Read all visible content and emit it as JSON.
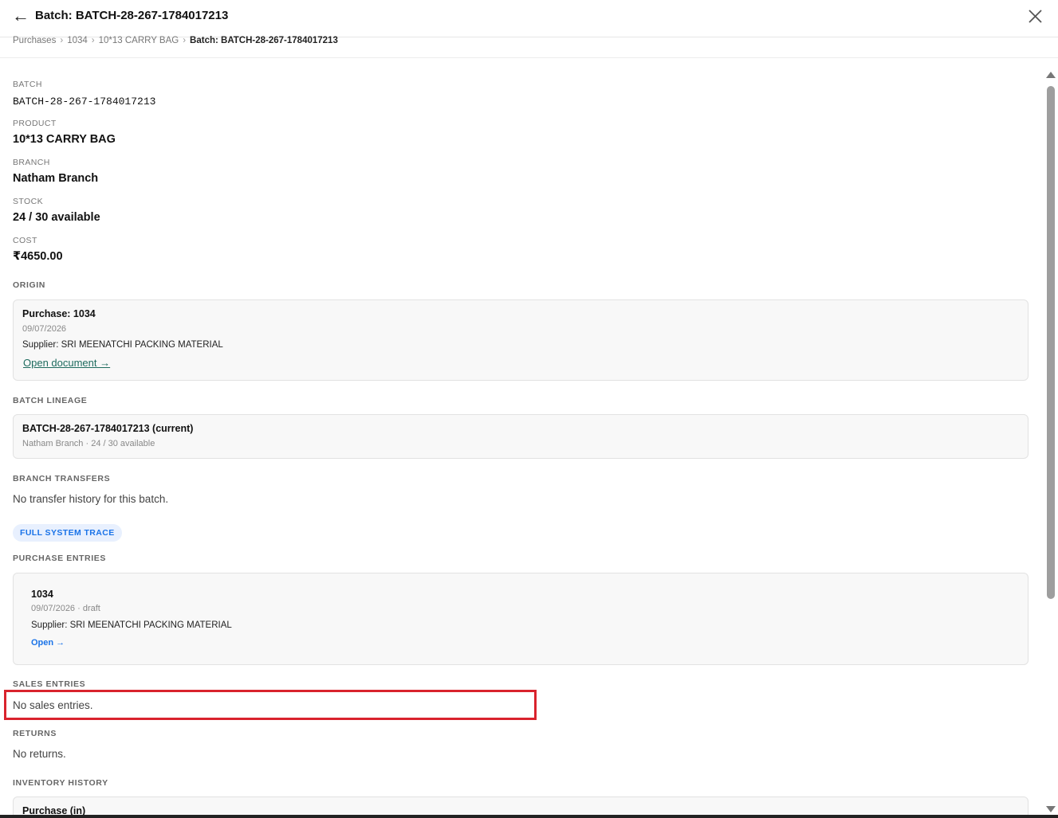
{
  "header": {
    "back_icon": "arrow-left-icon",
    "title": "Batch: BATCH-28-267-1784017213",
    "close_icon": "close-icon"
  },
  "breadcrumb": {
    "items": [
      "Purchases",
      "1034",
      "10*13 CARRY BAG"
    ],
    "current": "Batch: BATCH-28-267-1784017213",
    "separator": "›"
  },
  "details": {
    "batch_label": "BATCH",
    "batch_value": "BATCH-28-267-1784017213",
    "product_label": "PRODUCT",
    "product_value": "10*13 CARRY BAG",
    "branch_label": "BRANCH",
    "branch_value": "Natham Branch",
    "stock_label": "STOCK",
    "stock_value": "24 / 30 available",
    "cost_label": "COST",
    "cost_value": "₹4650.00"
  },
  "origin": {
    "label": "ORIGIN",
    "title": "Purchase: 1034",
    "date": "09/07/2026",
    "supplier": "Supplier: SRI MEENATCHI PACKING MATERIAL",
    "link": "Open document →"
  },
  "lineage": {
    "label": "BATCH LINEAGE",
    "title": "BATCH-28-267-1784017213 (current)",
    "sub": "Natham Branch · 24 / 30 available"
  },
  "transfers": {
    "label": "BRANCH TRANSFERS",
    "empty": "No transfer history for this batch."
  },
  "trace_pill": "FULL SYSTEM TRACE",
  "purchase_entries": {
    "label": "PURCHASE ENTRIES",
    "title": "1034",
    "sub": "09/07/2026 · draft",
    "supplier": "Supplier: SRI MEENATCHI PACKING MATERIAL",
    "link": "Open →"
  },
  "sales_entries": {
    "label": "SALES ENTRIES",
    "empty": "No sales entries."
  },
  "returns": {
    "label": "RETURNS",
    "empty": "No returns."
  },
  "inventory_history": {
    "label": "INVENTORY HISTORY",
    "first_title": "Purchase (in)"
  },
  "colors": {
    "highlight": "#d9232d",
    "link_green": "#1e6b5e",
    "link_blue": "#1a73e8",
    "pill_bg": "#e8f0fe"
  }
}
